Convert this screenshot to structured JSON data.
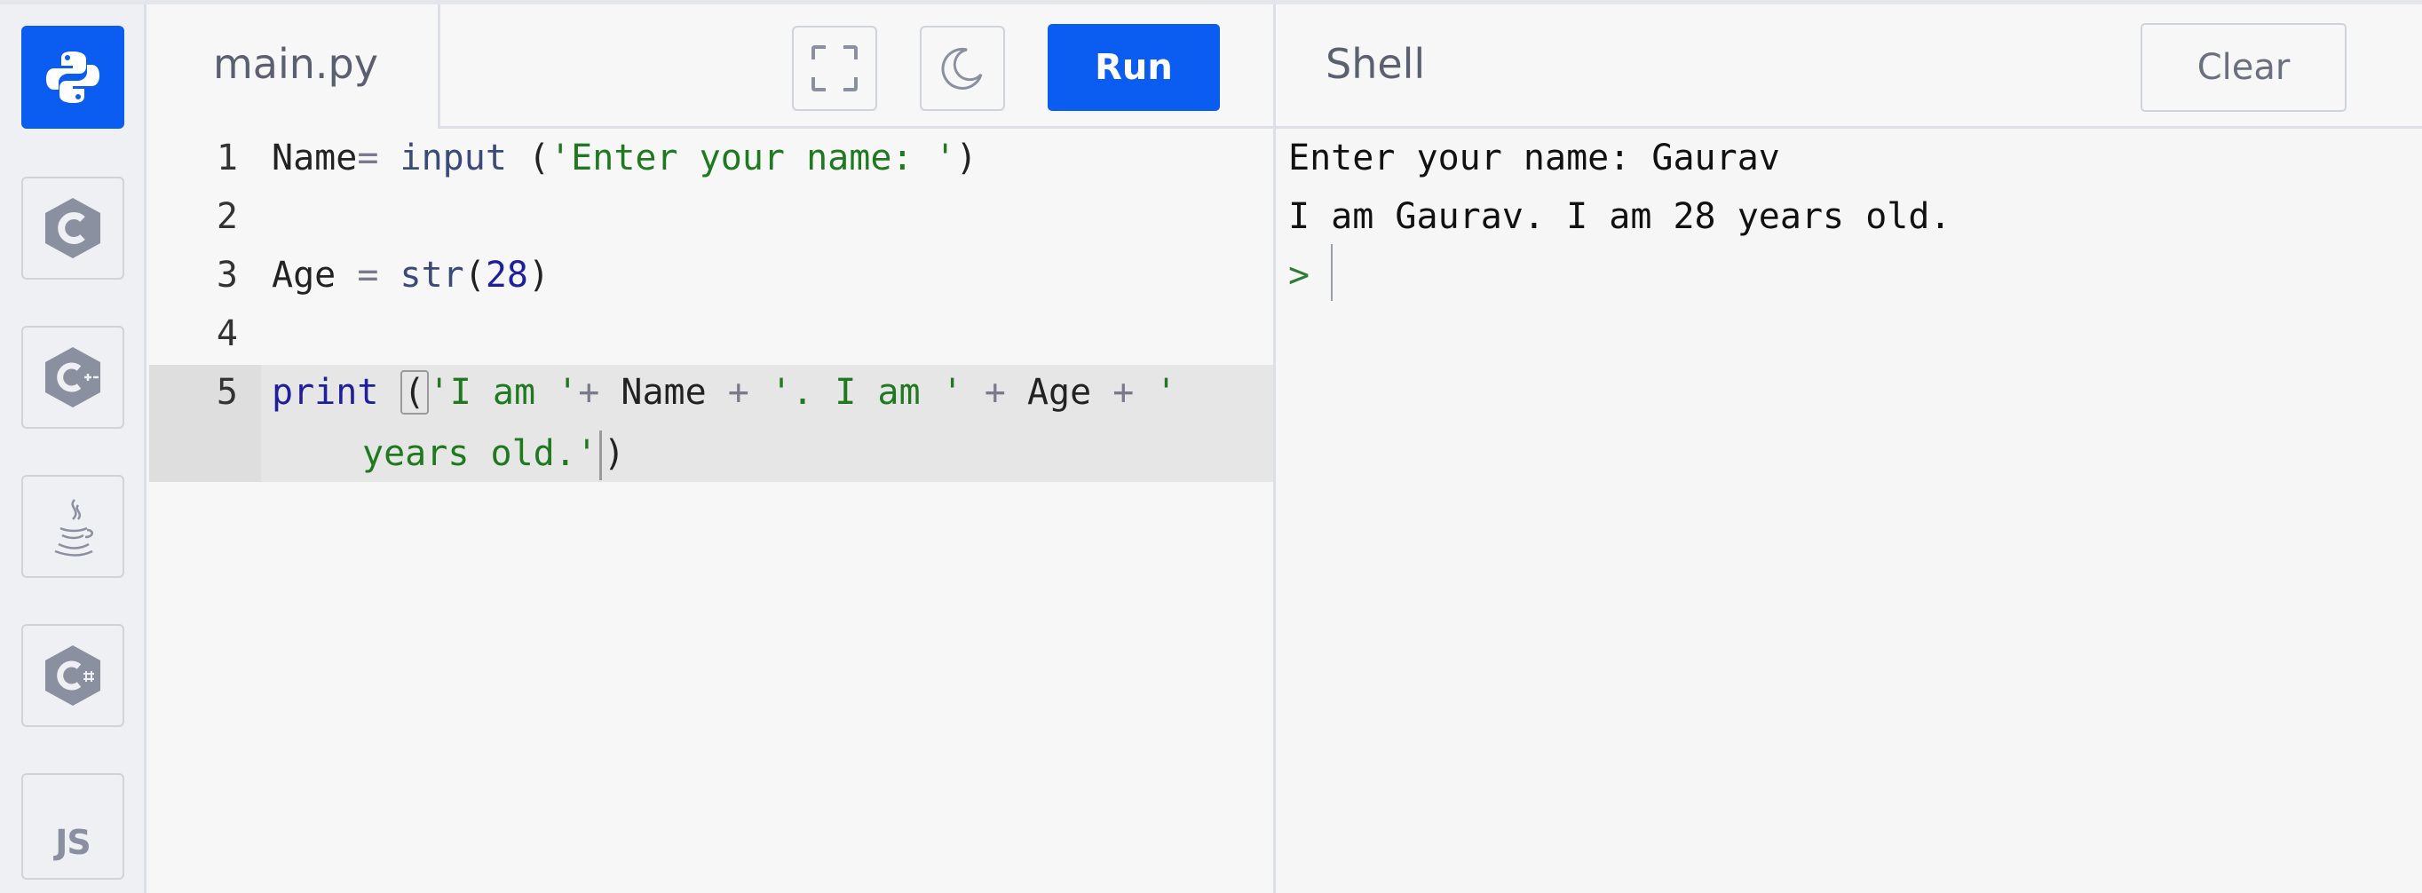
{
  "app": {
    "sidebar": {
      "languages": [
        {
          "name": "python-icon",
          "active": true
        },
        {
          "name": "c-icon",
          "active": false
        },
        {
          "name": "cpp-icon",
          "active": false
        },
        {
          "name": "java-icon",
          "active": false
        },
        {
          "name": "csharp-icon",
          "active": false
        },
        {
          "name": "js-icon",
          "active": false,
          "label": "JS"
        }
      ]
    },
    "editor": {
      "file_tab": "main.py",
      "fullscreen_icon": "fullscreen-icon",
      "theme_icon": "moon-icon",
      "run_label": "Run",
      "line_numbers": [
        "1",
        "2",
        "3",
        "4",
        "5"
      ],
      "code": {
        "line1": {
          "a": "Name",
          "b": "= ",
          "c": "input",
          "d": " (",
          "e": "'Enter your name: '",
          "f": ")"
        },
        "line3": {
          "a": "Age ",
          "b": "= ",
          "c": "str",
          "d": "(",
          "e": "28",
          "f": ")"
        },
        "line5": {
          "a": "print",
          "b": " ",
          "c": "(",
          "d": "'I am '",
          "e": "+ ",
          "f": "Name ",
          "g": "+ ",
          "h": "'. I am ' ",
          "i": "+ ",
          "j": "Age ",
          "k": "+ ",
          "l": "'"
        },
        "line5_wrap": {
          "a": "years old.'",
          "b": ")"
        }
      }
    },
    "shell": {
      "title": "Shell",
      "clear_label": "Clear",
      "output": [
        "Enter your name: Gaurav",
        "I am Gaurav. I am 28 years old."
      ],
      "prompt": ">"
    },
    "colors": {
      "accent": "#0b5cf0",
      "string": "#1f7a1f",
      "keyword": "#1f1f9e"
    }
  }
}
